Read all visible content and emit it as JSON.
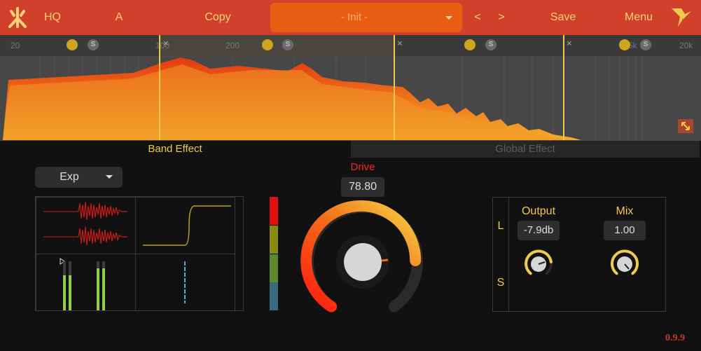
{
  "colors": {
    "bar": "#d1402a",
    "accent": "#f1c94b",
    "drive": "#ee2a20"
  },
  "topbar": {
    "quality": "HQ",
    "slot": "A",
    "copy": "Copy",
    "prev": "<",
    "next": ">",
    "save": "Save",
    "menu": "Menu"
  },
  "preset": {
    "name": "- Init -"
  },
  "freq_ticks": [
    "20",
    "100",
    "200",
    "1k",
    "5k",
    "10k",
    "20k"
  ],
  "bands": {
    "solo_label": "S",
    "close_glyph": "×"
  },
  "tabs": {
    "band": "Band Effect",
    "global": "Global Effect"
  },
  "mode": {
    "value": "Exp"
  },
  "drive": {
    "label": "Drive",
    "value": "78.80",
    "level": 0.79
  },
  "output": {
    "label": "Output",
    "value": "-7.9db"
  },
  "mix": {
    "label": "Mix",
    "value": "1.00"
  },
  "stereo": {
    "left": "L",
    "side": "S"
  },
  "version": "0.9.9"
}
